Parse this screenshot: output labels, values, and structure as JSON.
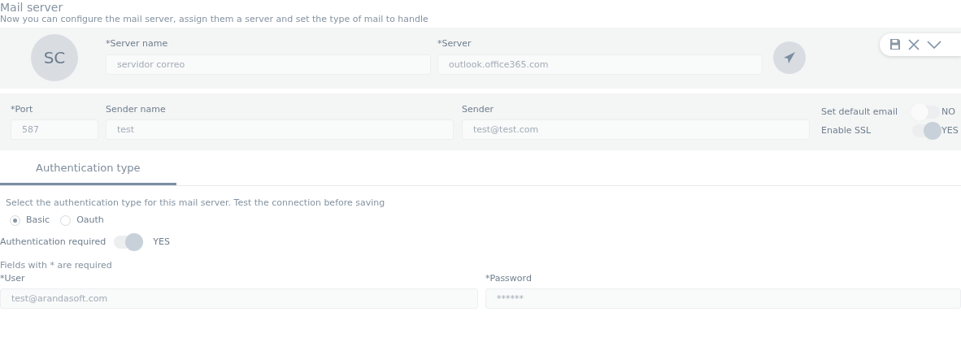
{
  "header": {
    "title": "Mail server",
    "subtitle": "Now you can configure the mail server, assign them a server and set the type of mail to handle"
  },
  "server_panel": {
    "avatar": "SC",
    "fields": [
      {
        "label": "*Server name",
        "value": "servidor correo"
      },
      {
        "label": "*Server",
        "value": "outlook.office365.com"
      }
    ]
  },
  "sender_panel": {
    "fields": [
      {
        "label": "*Port",
        "value": "587"
      },
      {
        "label": "Sender name",
        "value": "test"
      },
      {
        "label": "Sender",
        "value": "test@test.com"
      }
    ],
    "switches": [
      {
        "label": "Set default email",
        "on": false,
        "state_text": "NO"
      },
      {
        "label": "Enable SSL",
        "on": true,
        "state_text": "YES"
      }
    ]
  },
  "tabs": [
    {
      "label": "Authentication type",
      "selected": true
    }
  ],
  "auth": {
    "hint": "Select the authentication type for this mail server. Test the connection before saving",
    "options": [
      {
        "label": "Basic",
        "selected": true
      },
      {
        "label": "Oauth",
        "selected": false
      }
    ],
    "required_switch": {
      "label": "Authentication required",
      "on": true,
      "state_text": "YES"
    },
    "note": "Fields with * are required",
    "fields": [
      {
        "label": "*User",
        "value": "test@arandasoft.com"
      },
      {
        "label": "*Password",
        "value": "******"
      }
    ]
  }
}
